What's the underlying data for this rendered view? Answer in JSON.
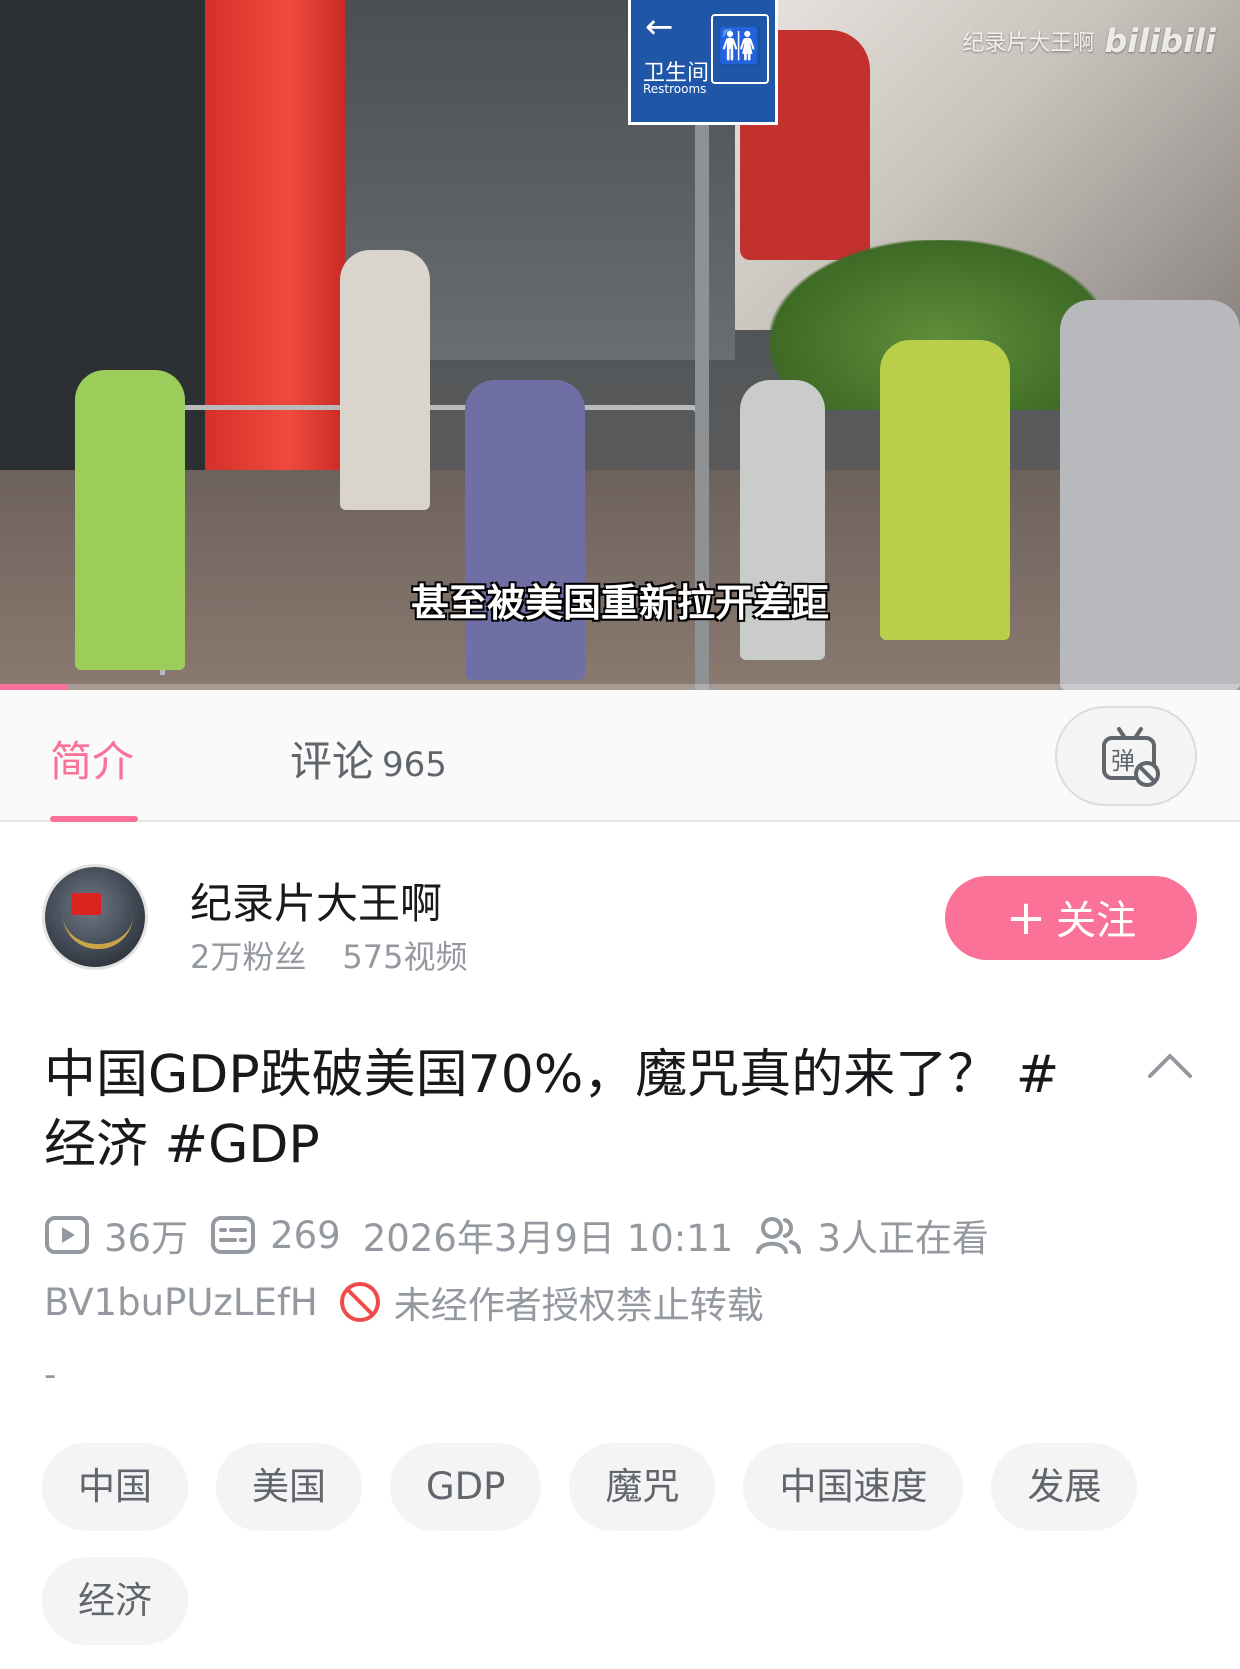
{
  "video": {
    "watermark_text": "纪录片大王啊",
    "watermark_logo": "bilibili",
    "subtitle": "甚至被美国重新拉开差距",
    "sign_text": "卫生间",
    "sign_sub": "Restrooms",
    "progress_fraction": 0.055
  },
  "tabs": {
    "intro_label": "简介",
    "comments_label": "评论",
    "comments_count": "965",
    "danmaku_icon": "danmaku-off-icon"
  },
  "uploader": {
    "name": "纪录片大王啊",
    "followers": "2万粉丝",
    "videos": "575视频",
    "follow_label": "关注",
    "follow_icon": "plus-icon"
  },
  "video_info": {
    "title": "中国GDP跌破美国70%，魔咒真的来了？ #经济 #GDP",
    "views": "36万",
    "danmaku_count": "269",
    "date": "2026年3月9日 10:11",
    "watching": "3人正在看",
    "bvid": "BV1buPUzLEfH",
    "copyright_notice": "未经作者授权禁止转载",
    "description": "-"
  },
  "tags": [
    "中国",
    "美国",
    "GDP",
    "魔咒",
    "中国速度",
    "发展",
    "经济"
  ],
  "colors": {
    "accent": "#fb7299",
    "muted_text": "#9499a0",
    "forbid_red": "#ef4b4b"
  }
}
